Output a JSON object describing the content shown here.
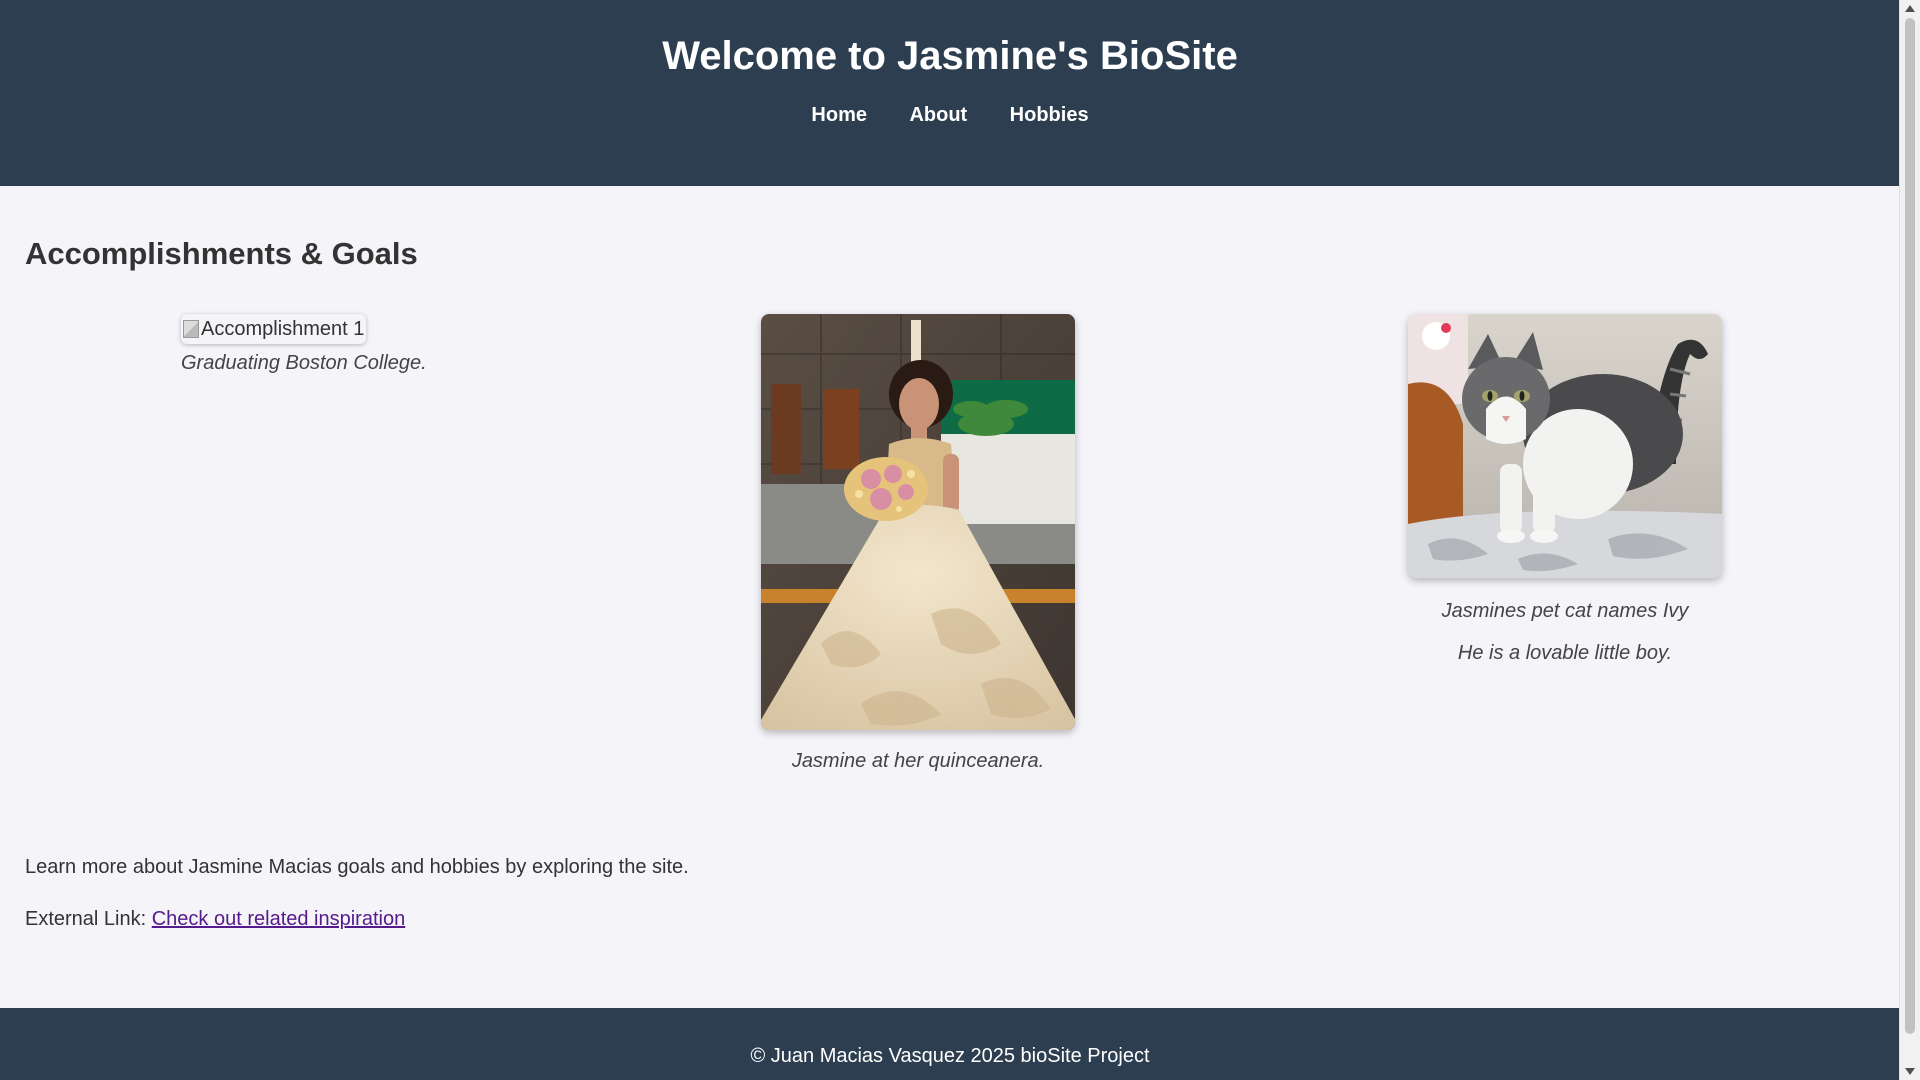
{
  "header": {
    "title": "Welcome to Jasmine's BioSite",
    "nav": [
      {
        "label": "Home"
      },
      {
        "label": "About"
      },
      {
        "label": "Hobbies"
      }
    ]
  },
  "main": {
    "heading": "Accomplishments & Goals",
    "gallery": [
      {
        "alt": "Accomplishment 1",
        "caption": "Graduating Boston College."
      },
      {
        "alt": "Jasmine at her quinceanera",
        "caption": "Jasmine at her quinceanera."
      },
      {
        "alt": "Jasmines pet cat",
        "caption": "Jasmines pet cat names Ivy",
        "caption2": "He is a lovable little boy."
      }
    ],
    "intro": "Learn more about Jasmine Macias goals and hobbies by exploring the site.",
    "external_label": "External Link:",
    "external_link": "Check out related inspiration"
  },
  "footer": {
    "text": "© Juan Macias Vasquez 2025 bioSite Project"
  },
  "colors": {
    "header_bg": "#2c3e50",
    "page_bg": "#f4f4f9",
    "link_visited": "#551a8b"
  }
}
